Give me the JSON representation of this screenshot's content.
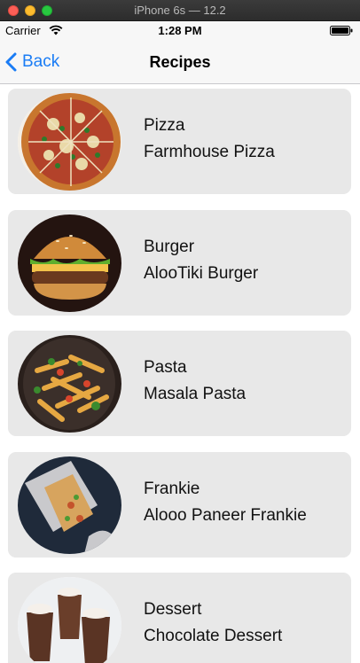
{
  "simulator": {
    "title": "iPhone 6s — 12.2"
  },
  "status_bar": {
    "carrier": "Carrier",
    "time": "1:28 PM"
  },
  "nav": {
    "back_label": "Back",
    "title": "Recipes"
  },
  "recipes": [
    {
      "category": "Pizza",
      "name": "Farmhouse Pizza"
    },
    {
      "category": "Burger",
      "name": "AlooTiki Burger"
    },
    {
      "category": "Pasta",
      "name": "Masala Pasta"
    },
    {
      "category": "Frankie",
      "name": "Alooo Paneer Frankie"
    },
    {
      "category": "Dessert",
      "name": "Chocolate Dessert"
    }
  ],
  "colors": {
    "accent": "#1a7cf5",
    "card_bg": "#e8e8e8",
    "nav_bg": "#f7f7f7"
  }
}
